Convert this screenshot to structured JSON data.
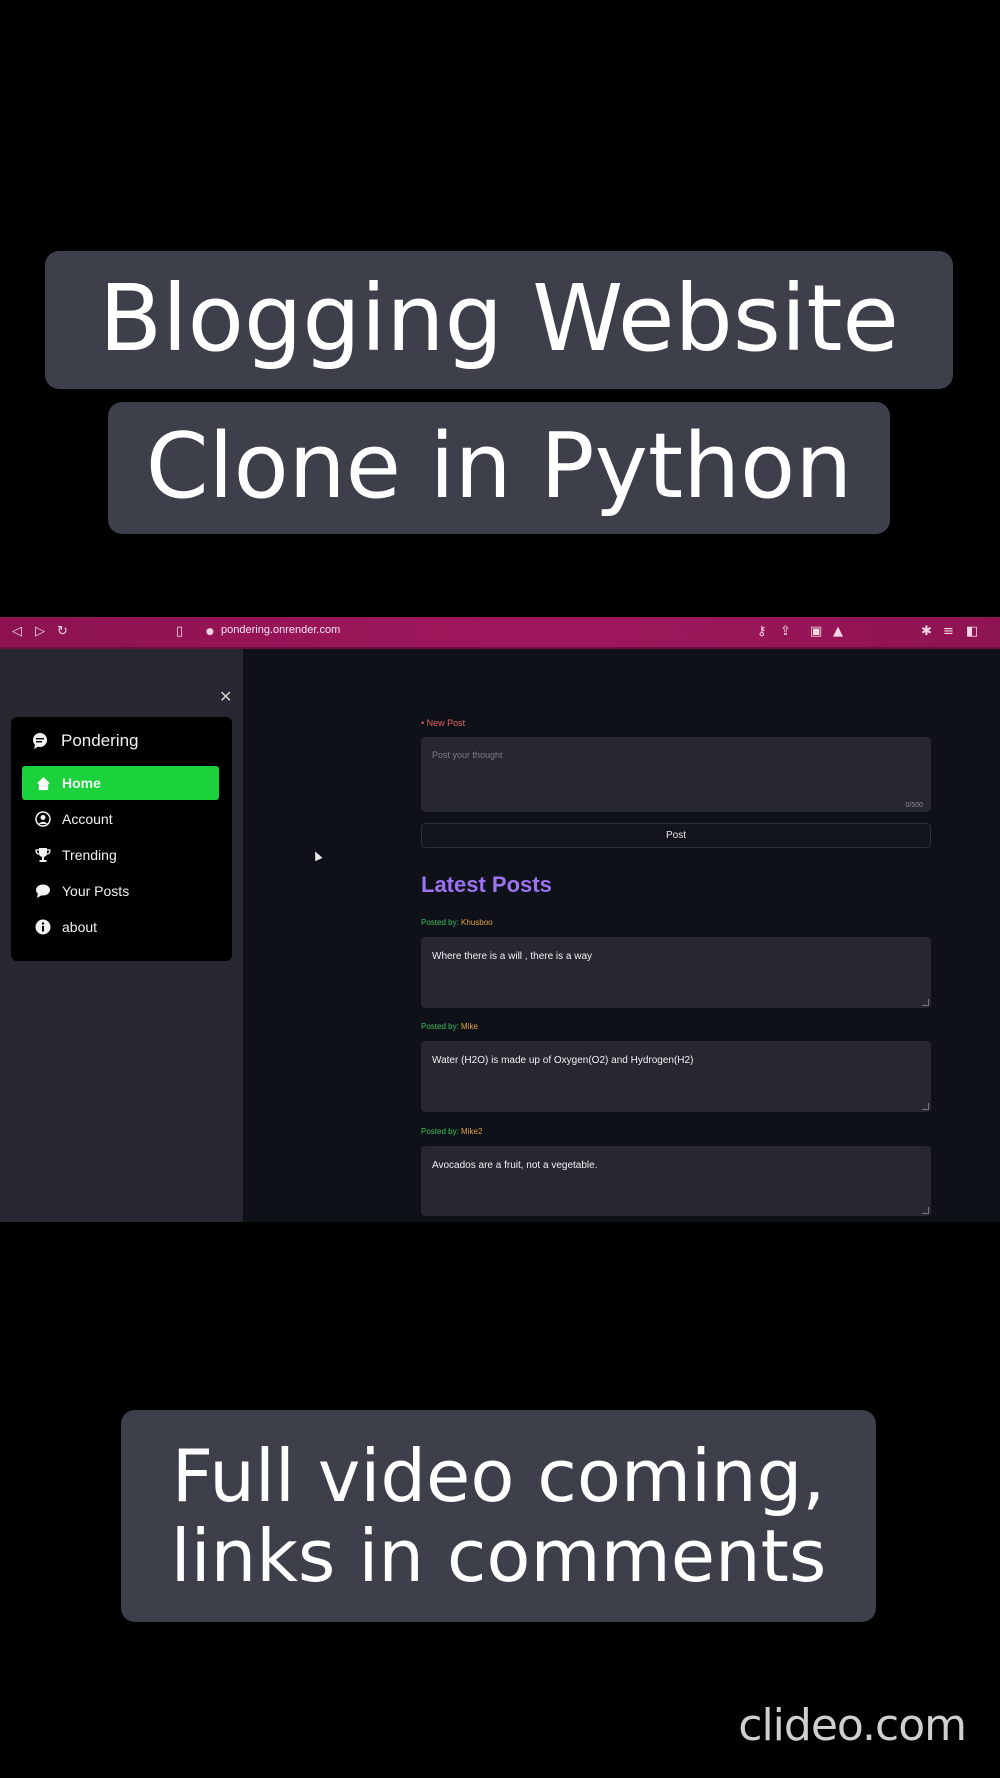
{
  "captions": {
    "title_line1": "Blogging Website",
    "title_line2": "Clone in Python",
    "footer_line1": "Full video coming,",
    "footer_line2": "links in comments"
  },
  "watermark": "clideo.com",
  "browser": {
    "url": "pondering.onrender.com",
    "accent": "#a0165d"
  },
  "sidebar": {
    "close_icon": "close-icon",
    "brand": "Pondering",
    "items": [
      {
        "label": "Home",
        "icon": "home-icon",
        "active": true
      },
      {
        "label": "Account",
        "icon": "account-icon",
        "active": false
      },
      {
        "label": "Trending",
        "icon": "trophy-icon",
        "active": false
      },
      {
        "label": "Your Posts",
        "icon": "chat-icon",
        "active": false
      },
      {
        "label": "about",
        "icon": "info-icon",
        "active": false
      }
    ],
    "active_color": "#1bd23c"
  },
  "main": {
    "new_post_label": "• New Post",
    "input_placeholder": "Post your thought",
    "char_count": "0/500",
    "post_button": "Post",
    "latest_heading": "Latest Posts",
    "posted_by_prefix": "Posted by:",
    "posts": [
      {
        "author": "Khusboo",
        "content": "Where there is a will , there is a way"
      },
      {
        "author": "Mike",
        "content": "Water (H2O) is made up of Oxygen(O2) and Hydrogen(H2)"
      },
      {
        "author": "Mike2",
        "content": "Avocados are a fruit, not a vegetable."
      }
    ],
    "heading_color": "#9b72f0"
  }
}
